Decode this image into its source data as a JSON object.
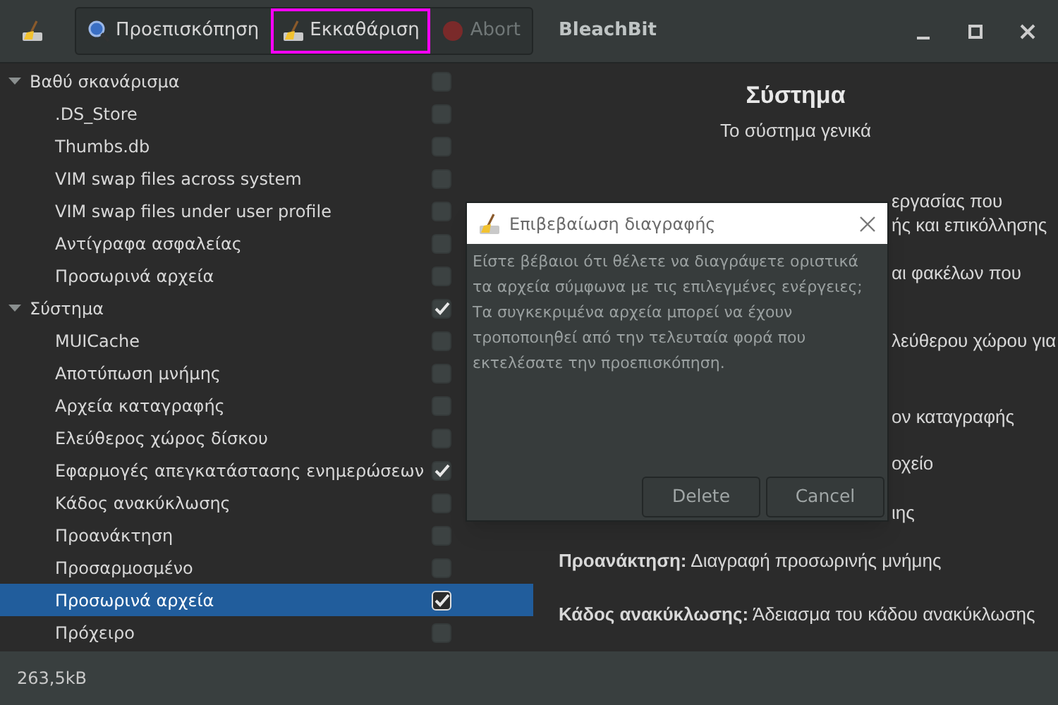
{
  "window": {
    "title": "BleachBit"
  },
  "toolbar": [
    {
      "label": "Προεπισκόπηση",
      "kind": "preview",
      "disabled": false,
      "outlined": false
    },
    {
      "label": "Εκκαθάριση",
      "kind": "clean",
      "disabled": false,
      "outlined": true
    },
    {
      "label": "Abort",
      "kind": "abort",
      "disabled": true,
      "outlined": false
    }
  ],
  "tree": [
    {
      "label": "Βαθύ σκανάρισμα",
      "expanded": true,
      "checked": false,
      "selected": false,
      "children": [
        {
          "label": ".DS_Store",
          "checked": false,
          "selected": false
        },
        {
          "label": "Thumbs.db",
          "checked": false,
          "selected": false
        },
        {
          "label": "VIM swap files across system",
          "checked": false,
          "selected": false
        },
        {
          "label": "VIM swap files under user profile",
          "checked": false,
          "selected": false
        },
        {
          "label": "Αντίγραφα ασφαλείας",
          "checked": false,
          "selected": false
        },
        {
          "label": "Προσωρινά αρχεία",
          "checked": false,
          "selected": false
        }
      ]
    },
    {
      "label": "Σύστημα",
      "expanded": true,
      "checked": true,
      "selected": false,
      "children": [
        {
          "label": "MUICache",
          "checked": false,
          "selected": false
        },
        {
          "label": "Αποτύπωση μνήμης",
          "checked": false,
          "selected": false
        },
        {
          "label": "Αρχεία καταγραφής",
          "checked": false,
          "selected": false
        },
        {
          "label": "Ελεύθερος χώρος δίσκου",
          "checked": false,
          "selected": false
        },
        {
          "label": "Εφαρμογές απεγκατάστασης ενημερώσεων",
          "checked": true,
          "selected": false
        },
        {
          "label": "Κάδος ανακύκλωσης",
          "checked": false,
          "selected": false
        },
        {
          "label": "Προανάκτηση",
          "checked": false,
          "selected": false
        },
        {
          "label": "Προσαρμοσμένο",
          "checked": false,
          "selected": false
        },
        {
          "label": "Προσωρινά αρχεία",
          "checked": true,
          "selected": true
        },
        {
          "label": "Πρόχειρο",
          "checked": false,
          "selected": false
        }
      ]
    }
  ],
  "details": {
    "title": "Σύστημα",
    "subtitle": "Το σύστημα γενικά",
    "fragments": [
      "εργασίας που",
      "ής και επικόλλησης",
      "αι φακέλων που",
      "λεύθερου χώρου για",
      "ον καταγραφής",
      "οχείο",
      "ιης"
    ],
    "entries": [
      {
        "term": "Προανάκτηση:",
        "text": "Διαγραφή προσωρινής μνήμης"
      },
      {
        "term": "Κάδος ανακύκλωσης:",
        "text": "Άδειασμα του κάδου ανακύκλωσης"
      }
    ]
  },
  "dialog": {
    "title": "Επιβεβαίωση διαγραφής",
    "message": "Είστε βέβαιοι ότι θέλετε να διαγράψετε οριστικά τα αρχεία σύμφωνα με τις επιλεγμένες ενέργειες; Τα συγκεκριμένα αρχεία μπορεί να έχουν τροποποιηθεί από την τελευταία φορά που εκτελέσατε την προεπισκόπηση.",
    "buttons": [
      "Delete",
      "Cancel"
    ]
  },
  "status_bar": "263,5kB"
}
